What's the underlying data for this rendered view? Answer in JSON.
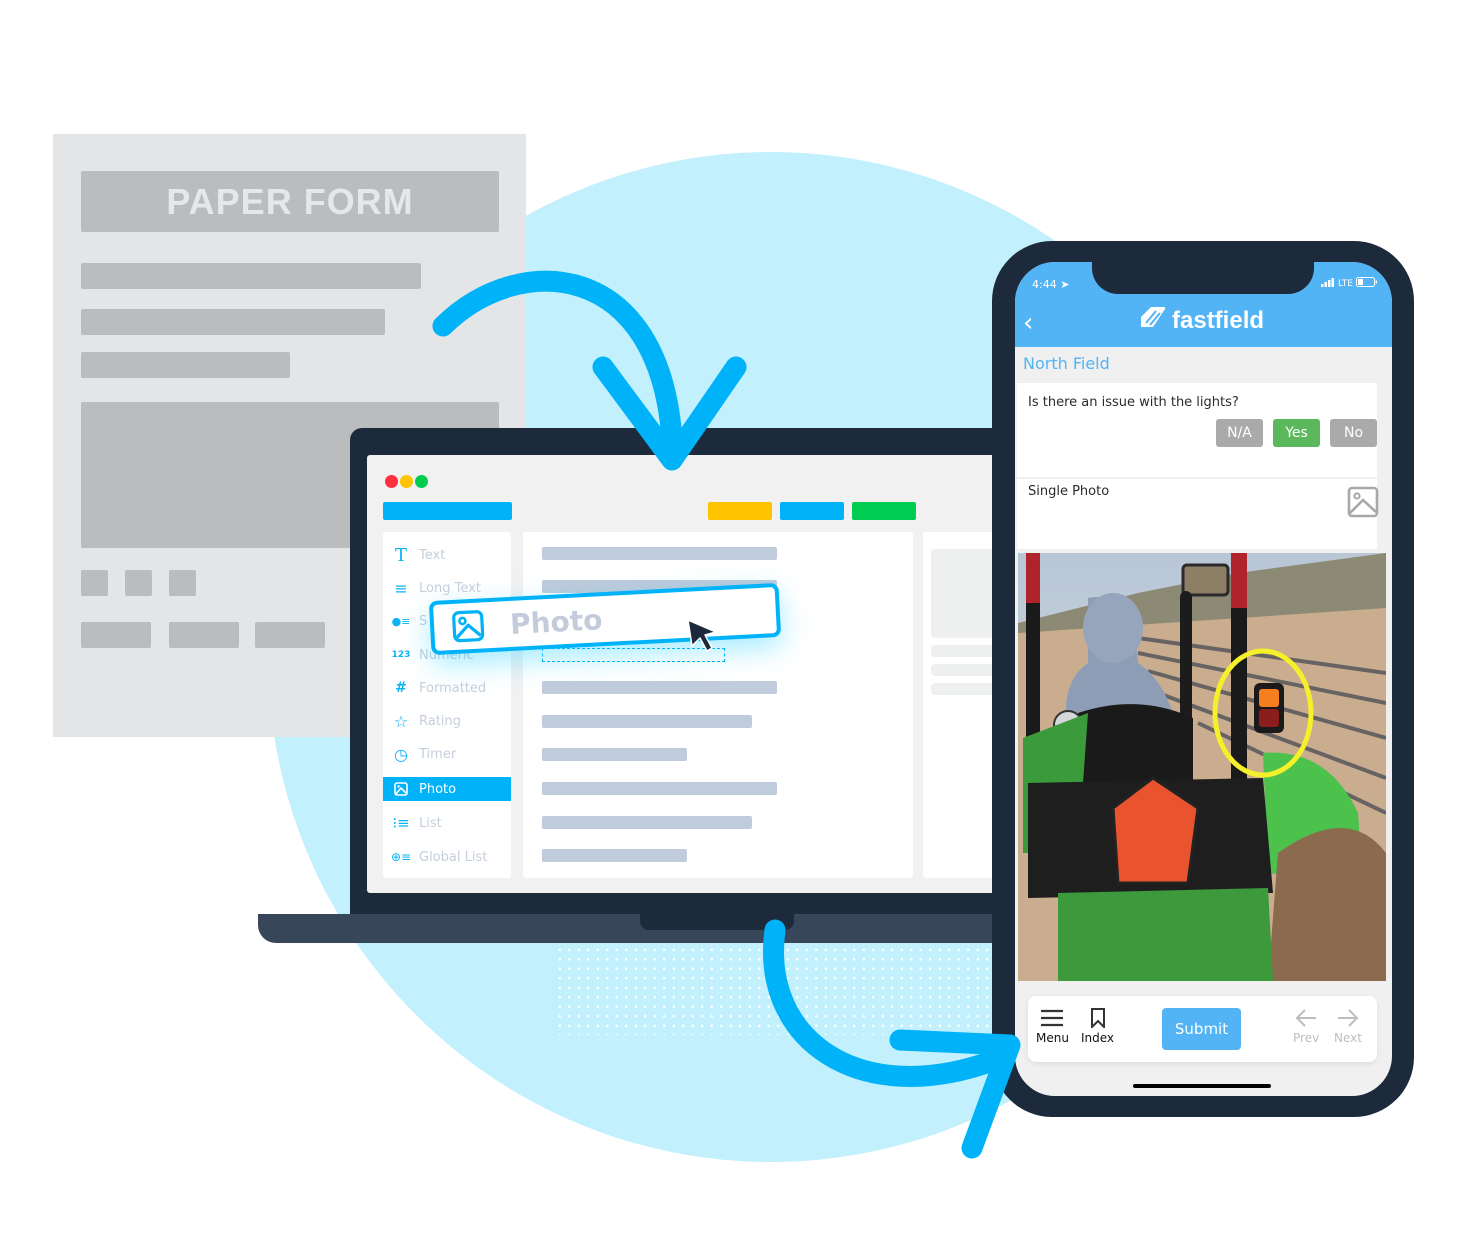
{
  "paper_form": {
    "title": "PAPER FORM"
  },
  "laptop": {
    "window_controls": [
      {
        "name": "close",
        "color": "#ff2e3f"
      },
      {
        "name": "minimize",
        "color": "#ffc400"
      },
      {
        "name": "maximize",
        "color": "#00cc52"
      }
    ],
    "toolbar_colors": [
      "#00b3f9",
      "#ffc400",
      "#00b3f9",
      "#00cc52"
    ],
    "sidebar": {
      "items": [
        {
          "label": "Text",
          "icon": "text-t-icon",
          "glyph": "T",
          "active": false
        },
        {
          "label": "Long Text",
          "icon": "long-text-icon",
          "glyph": "≡",
          "active": false
        },
        {
          "label": "S",
          "icon": "select-list-icon",
          "glyph": "•≡",
          "active": false
        },
        {
          "label": "Numeric",
          "icon": "numeric-123-icon",
          "glyph": "123",
          "active": false
        },
        {
          "label": "Formatted",
          "icon": "hash-icon",
          "glyph": "#",
          "active": false
        },
        {
          "label": "Rating",
          "icon": "star-icon",
          "glyph": "☆",
          "active": false
        },
        {
          "label": "Timer",
          "icon": "timer-icon",
          "glyph": "◷",
          "active": false
        },
        {
          "label": "Photo",
          "icon": "image-icon",
          "glyph": "▣",
          "active": true
        },
        {
          "label": "List",
          "icon": "list-icon",
          "glyph": "⋮≡",
          "active": false
        },
        {
          "label": "Global List",
          "icon": "global-list-icon",
          "glyph": "⊕≡",
          "active": false
        }
      ]
    },
    "drag_chip": {
      "label": "Photo",
      "icon": "image-icon"
    }
  },
  "phone": {
    "status_bar": {
      "time": "4:44",
      "network": "LTE"
    },
    "brand": "fastfield",
    "section_title": "North Field",
    "question": {
      "text": "Is there an issue with the lights?",
      "options": [
        {
          "label": "N/A",
          "selected": false
        },
        {
          "label": "Yes",
          "selected": true
        },
        {
          "label": "No",
          "selected": false
        }
      ],
      "selected_color": "#5cb85c",
      "unselected_color": "#aaaaaa"
    },
    "photo_field": {
      "label": "Single Photo"
    },
    "toolbar": {
      "menu": "Menu",
      "index": "Index",
      "submit": "Submit",
      "prev": "Prev",
      "next": "Next"
    }
  },
  "colors": {
    "accent": "#00b3f9",
    "phone_header": "#52b3f5",
    "device_frame": "#1c2a3b",
    "background_circle": "#c2f0fd",
    "highlight_ring": "#f5f02a"
  }
}
